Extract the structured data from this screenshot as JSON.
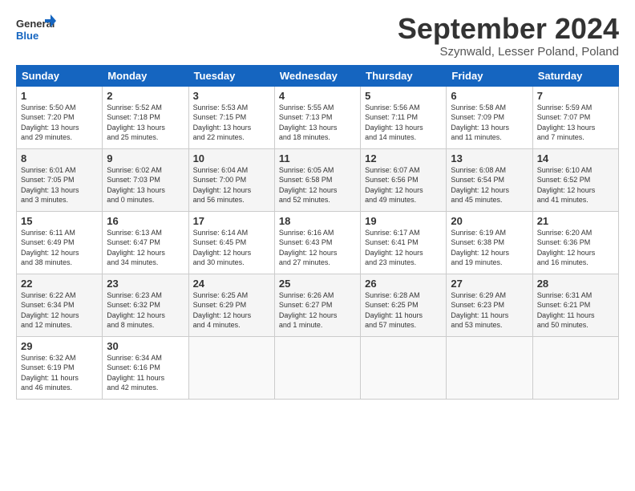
{
  "header": {
    "logo_general": "General",
    "logo_blue": "Blue",
    "month_title": "September 2024",
    "location": "Szynwald, Lesser Poland, Poland"
  },
  "weekdays": [
    "Sunday",
    "Monday",
    "Tuesday",
    "Wednesday",
    "Thursday",
    "Friday",
    "Saturday"
  ],
  "weeks": [
    [
      {
        "day": "1",
        "info": "Sunrise: 5:50 AM\nSunset: 7:20 PM\nDaylight: 13 hours\nand 29 minutes."
      },
      {
        "day": "2",
        "info": "Sunrise: 5:52 AM\nSunset: 7:18 PM\nDaylight: 13 hours\nand 25 minutes."
      },
      {
        "day": "3",
        "info": "Sunrise: 5:53 AM\nSunset: 7:15 PM\nDaylight: 13 hours\nand 22 minutes."
      },
      {
        "day": "4",
        "info": "Sunrise: 5:55 AM\nSunset: 7:13 PM\nDaylight: 13 hours\nand 18 minutes."
      },
      {
        "day": "5",
        "info": "Sunrise: 5:56 AM\nSunset: 7:11 PM\nDaylight: 13 hours\nand 14 minutes."
      },
      {
        "day": "6",
        "info": "Sunrise: 5:58 AM\nSunset: 7:09 PM\nDaylight: 13 hours\nand 11 minutes."
      },
      {
        "day": "7",
        "info": "Sunrise: 5:59 AM\nSunset: 7:07 PM\nDaylight: 13 hours\nand 7 minutes."
      }
    ],
    [
      {
        "day": "8",
        "info": "Sunrise: 6:01 AM\nSunset: 7:05 PM\nDaylight: 13 hours\nand 3 minutes."
      },
      {
        "day": "9",
        "info": "Sunrise: 6:02 AM\nSunset: 7:03 PM\nDaylight: 13 hours\nand 0 minutes."
      },
      {
        "day": "10",
        "info": "Sunrise: 6:04 AM\nSunset: 7:00 PM\nDaylight: 12 hours\nand 56 minutes."
      },
      {
        "day": "11",
        "info": "Sunrise: 6:05 AM\nSunset: 6:58 PM\nDaylight: 12 hours\nand 52 minutes."
      },
      {
        "day": "12",
        "info": "Sunrise: 6:07 AM\nSunset: 6:56 PM\nDaylight: 12 hours\nand 49 minutes."
      },
      {
        "day": "13",
        "info": "Sunrise: 6:08 AM\nSunset: 6:54 PM\nDaylight: 12 hours\nand 45 minutes."
      },
      {
        "day": "14",
        "info": "Sunrise: 6:10 AM\nSunset: 6:52 PM\nDaylight: 12 hours\nand 41 minutes."
      }
    ],
    [
      {
        "day": "15",
        "info": "Sunrise: 6:11 AM\nSunset: 6:49 PM\nDaylight: 12 hours\nand 38 minutes."
      },
      {
        "day": "16",
        "info": "Sunrise: 6:13 AM\nSunset: 6:47 PM\nDaylight: 12 hours\nand 34 minutes."
      },
      {
        "day": "17",
        "info": "Sunrise: 6:14 AM\nSunset: 6:45 PM\nDaylight: 12 hours\nand 30 minutes."
      },
      {
        "day": "18",
        "info": "Sunrise: 6:16 AM\nSunset: 6:43 PM\nDaylight: 12 hours\nand 27 minutes."
      },
      {
        "day": "19",
        "info": "Sunrise: 6:17 AM\nSunset: 6:41 PM\nDaylight: 12 hours\nand 23 minutes."
      },
      {
        "day": "20",
        "info": "Sunrise: 6:19 AM\nSunset: 6:38 PM\nDaylight: 12 hours\nand 19 minutes."
      },
      {
        "day": "21",
        "info": "Sunrise: 6:20 AM\nSunset: 6:36 PM\nDaylight: 12 hours\nand 16 minutes."
      }
    ],
    [
      {
        "day": "22",
        "info": "Sunrise: 6:22 AM\nSunset: 6:34 PM\nDaylight: 12 hours\nand 12 minutes."
      },
      {
        "day": "23",
        "info": "Sunrise: 6:23 AM\nSunset: 6:32 PM\nDaylight: 12 hours\nand 8 minutes."
      },
      {
        "day": "24",
        "info": "Sunrise: 6:25 AM\nSunset: 6:29 PM\nDaylight: 12 hours\nand 4 minutes."
      },
      {
        "day": "25",
        "info": "Sunrise: 6:26 AM\nSunset: 6:27 PM\nDaylight: 12 hours\nand 1 minute."
      },
      {
        "day": "26",
        "info": "Sunrise: 6:28 AM\nSunset: 6:25 PM\nDaylight: 11 hours\nand 57 minutes."
      },
      {
        "day": "27",
        "info": "Sunrise: 6:29 AM\nSunset: 6:23 PM\nDaylight: 11 hours\nand 53 minutes."
      },
      {
        "day": "28",
        "info": "Sunrise: 6:31 AM\nSunset: 6:21 PM\nDaylight: 11 hours\nand 50 minutes."
      }
    ],
    [
      {
        "day": "29",
        "info": "Sunrise: 6:32 AM\nSunset: 6:19 PM\nDaylight: 11 hours\nand 46 minutes."
      },
      {
        "day": "30",
        "info": "Sunrise: 6:34 AM\nSunset: 6:16 PM\nDaylight: 11 hours\nand 42 minutes."
      },
      {
        "day": "",
        "info": ""
      },
      {
        "day": "",
        "info": ""
      },
      {
        "day": "",
        "info": ""
      },
      {
        "day": "",
        "info": ""
      },
      {
        "day": "",
        "info": ""
      }
    ]
  ]
}
